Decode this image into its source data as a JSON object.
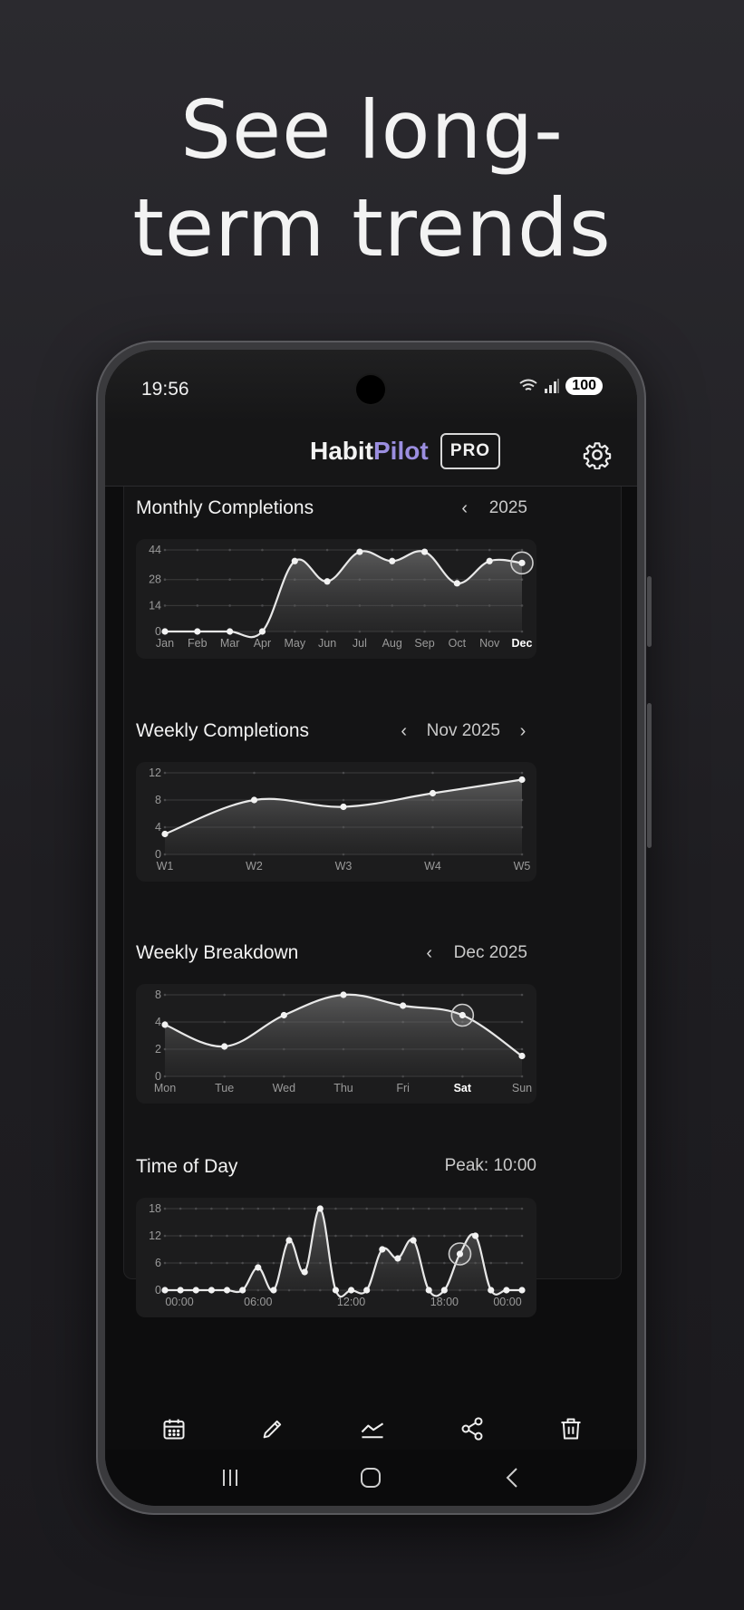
{
  "headline": {
    "line1": "See long-",
    "line2": "term trends"
  },
  "status": {
    "time": "19:56",
    "battery": "100"
  },
  "app": {
    "brand_main": "Habit",
    "brand_accent": "Pilot",
    "badge": "PRO"
  },
  "colors": {
    "accent": "#9b8ee0",
    "line": "#e8e8e8",
    "background": "#141415",
    "card": "#1c1c1d"
  },
  "icons": [
    "gear-icon",
    "calendar-icon",
    "pencil-icon",
    "trend-icon",
    "share-icon",
    "trash-icon",
    "recent-apps-icon",
    "home-icon",
    "back-icon"
  ],
  "sections": {
    "monthly": {
      "title": "Monthly Completions",
      "year": "2025"
    },
    "weekly": {
      "title": "Weekly Completions",
      "period": "Nov 2025"
    },
    "breakdown": {
      "title": "Weekly Breakdown",
      "period": "Dec 2025"
    },
    "timeofday": {
      "title": "Time of Day",
      "peak": "Peak: 10:00"
    }
  },
  "chart_data": [
    {
      "id": "monthly",
      "type": "area",
      "categories": [
        "Jan",
        "Feb",
        "Mar",
        "Apr",
        "May",
        "Jun",
        "Jul",
        "Aug",
        "Sep",
        "Oct",
        "Nov",
        "Dec"
      ],
      "values": [
        0,
        0,
        0,
        0,
        38,
        27,
        43,
        38,
        43,
        26,
        38,
        37
      ],
      "yticks": [
        "0",
        "14",
        "28",
        "44"
      ],
      "ylim": [
        0,
        44
      ],
      "highlight_index": 11,
      "grid": true
    },
    {
      "id": "weekly",
      "type": "area",
      "categories": [
        "W1",
        "W2",
        "W3",
        "W4",
        "W5"
      ],
      "values": [
        3,
        8,
        7,
        9,
        11
      ],
      "yticks": [
        "0",
        "4",
        "8",
        "12"
      ],
      "ylim": [
        0,
        12
      ],
      "highlight_index": -1,
      "grid": true
    },
    {
      "id": "breakdown",
      "type": "area",
      "categories": [
        "Mon",
        "Tue",
        "Wed",
        "Thu",
        "Fri",
        "Sat",
        "Sun"
      ],
      "values": [
        3.8,
        2.2,
        4.5,
        6,
        5.2,
        4.5,
        1.5
      ],
      "yticks": [
        "0",
        "2",
        "4",
        "8"
      ],
      "ytick_values": [
        0,
        2,
        4,
        6
      ],
      "ylim": [
        0,
        6
      ],
      "highlight_index": 5,
      "grid": true
    },
    {
      "id": "timeofday",
      "type": "area",
      "categories": [
        "00:00",
        "",
        "",
        "",
        "",
        "",
        "06:00",
        "",
        "",
        "",
        "",
        "",
        "12:00",
        "",
        "",
        "",
        "",
        "",
        "18:00",
        "",
        "",
        "",
        "",
        "00:00"
      ],
      "values": [
        0,
        0,
        0,
        0,
        0,
        0,
        5,
        0,
        11,
        4,
        18,
        0,
        0,
        0,
        9,
        7,
        11,
        0,
        0,
        8,
        12,
        0,
        0,
        0
      ],
      "yticks": [
        "0",
        "6",
        "12",
        "18"
      ],
      "ylim": [
        0,
        18
      ],
      "highlight_index": 19,
      "grid": true
    }
  ]
}
